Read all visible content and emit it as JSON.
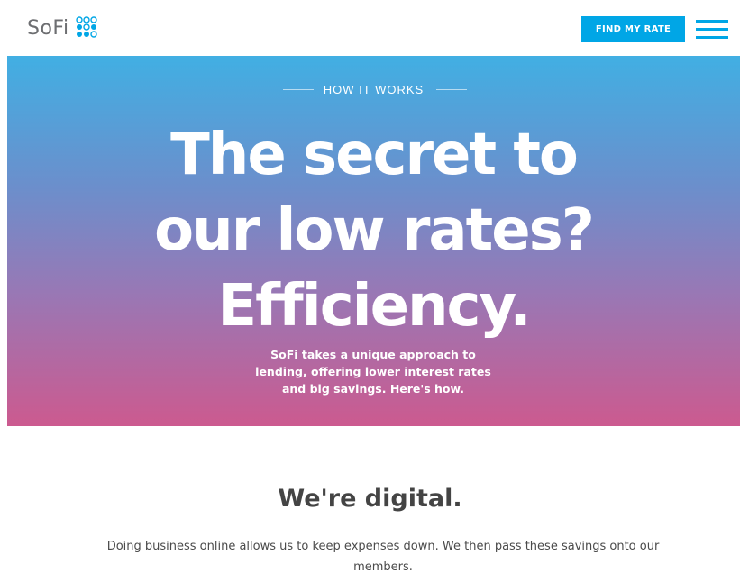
{
  "header": {
    "logo_text": "SoFi",
    "find_rate_label": "FIND MY RATE",
    "accent_color": "#00a6e6"
  },
  "hero": {
    "eyebrow": "HOW IT WORKS",
    "headline_lines": [
      "The secret to",
      "our low rates?",
      "Efficiency."
    ],
    "subtext_lines": [
      "SoFi takes a unique approach to",
      "lending, offering lower interest rates",
      "and big savings. Here's how."
    ]
  },
  "section": {
    "title": "We're digital.",
    "body_lines": [
      "Doing business online allows us to keep expenses down. We then pass these savings onto our",
      "members."
    ]
  },
  "icons": {
    "logo": "sofi-dots-logo",
    "menu": "hamburger-menu-icon"
  }
}
